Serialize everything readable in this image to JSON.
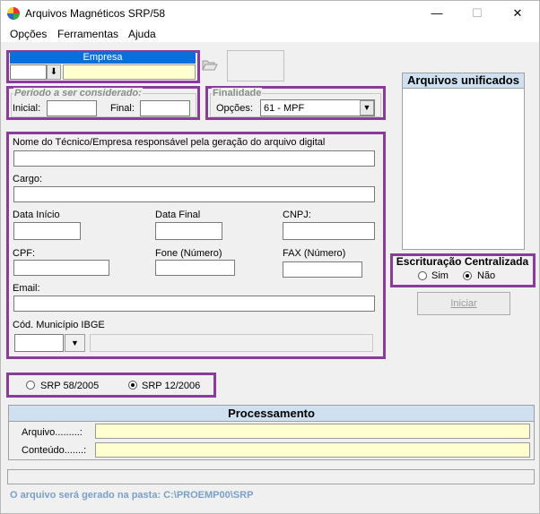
{
  "window": {
    "title": "Arquivos Magnéticos SRP/58",
    "minimize": "—",
    "maximize": "☐",
    "close": "✕"
  },
  "menu": [
    "Opções",
    "Ferramentas",
    "Ajuda"
  ],
  "empresa": {
    "header": "Empresa",
    "code_value": "",
    "name_value": ""
  },
  "periodo": {
    "legend": "Período a ser considerado:",
    "inicial_label": "Inicial:",
    "final_label": "Final:",
    "inicial_value": "",
    "final_value": ""
  },
  "finalidade": {
    "legend": "Finalidade",
    "opcoes_label": "Opções:",
    "selected": "61 - MPF"
  },
  "tecnico": {
    "nome_label": "Nome do Técnico/Empresa responsável pela geração do arquivo digital",
    "cargo_label": "Cargo:",
    "data_inicio_label": "Data Início",
    "data_final_label": "Data Final",
    "cnpj_label": "CNPJ:",
    "cpf_label": "CPF:",
    "fone_label": "Fone (Número)",
    "fax_label": "FAX (Número)",
    "email_label": "Email:",
    "municipio_label": "Cód. Município IBGE"
  },
  "unificados": {
    "title": "Arquivos unificados"
  },
  "escrituracao": {
    "title": "Escrituração Centralizada",
    "sim": "Sim",
    "nao": "Não",
    "selected": "Não"
  },
  "iniciar_label": "Iniciar",
  "srp": {
    "opt1": "SRP 58/2005",
    "opt2": "SRP 12/2006",
    "selected": "SRP 12/2006"
  },
  "processamento": {
    "title": "Processamento",
    "arquivo_label": "Arquivo.........:",
    "conteudo_label": "Conteúdo.......:",
    "arquivo_value": "",
    "conteudo_value": ""
  },
  "status_text": "O arquivo será gerado na pasta: C:\\PROEMP00\\SRP",
  "colors": {
    "purple": "#8a3c9a",
    "blue_header": "#0a6fd8",
    "yellow_field": "#ffffd0",
    "status_blue": "#7b9fc8"
  }
}
